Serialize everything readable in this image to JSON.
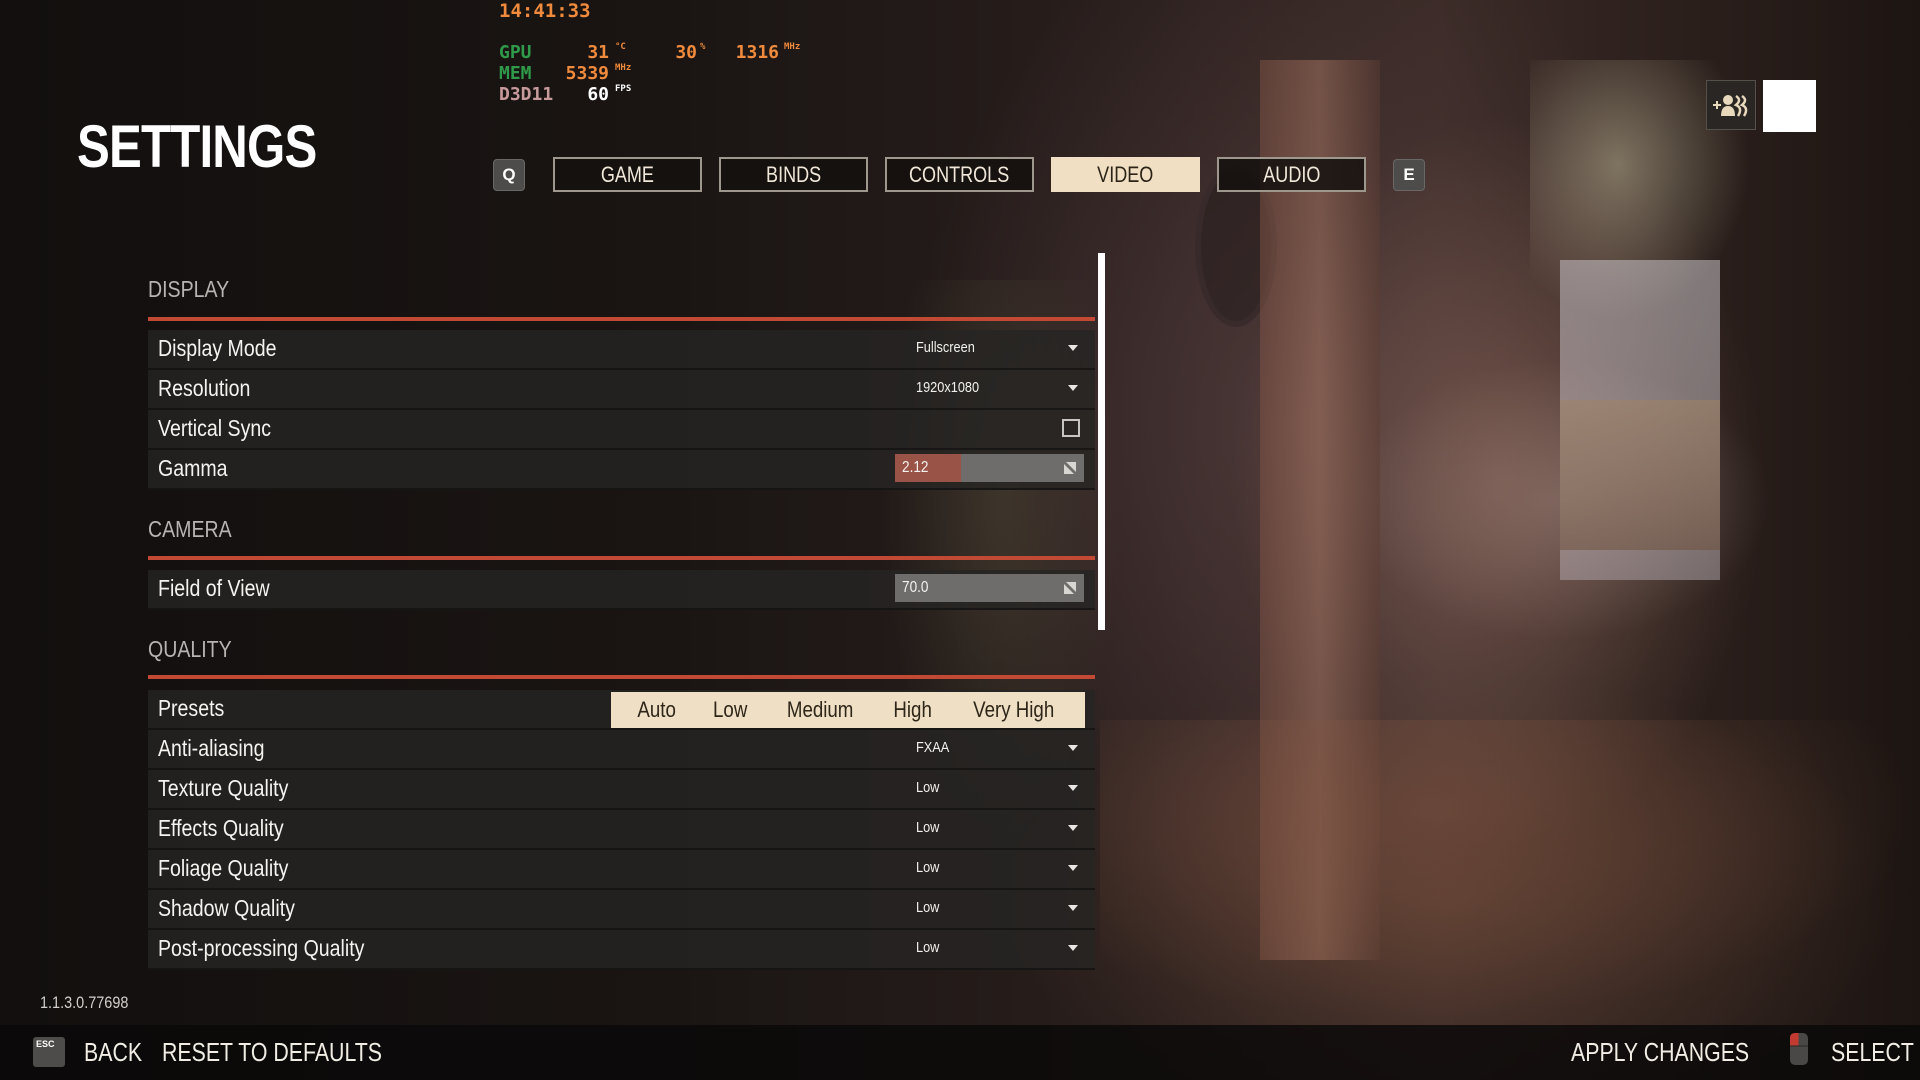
{
  "hud": {
    "time": "14:41:33",
    "gpu": {
      "label": "GPU",
      "temp": "31",
      "temp_unit": "°C",
      "load": "30",
      "load_unit": "%",
      "clock": "1316",
      "clock_unit": "MHz"
    },
    "mem": {
      "label": "MEM",
      "clock": "5339",
      "clock_unit": "MHz"
    },
    "api": {
      "label": "D3D11",
      "fps": "60",
      "fps_unit": "FPS"
    }
  },
  "page_title": "SETTINGS",
  "tabs": {
    "prev_key": "Q",
    "next_key": "E",
    "items": [
      {
        "label": "GAME",
        "active": false
      },
      {
        "label": "BINDS",
        "active": false
      },
      {
        "label": "CONTROLS",
        "active": false
      },
      {
        "label": "VIDEO",
        "active": true
      },
      {
        "label": "AUDIO",
        "active": false
      }
    ]
  },
  "top_right": {
    "squad_icon": "add-squad-icon"
  },
  "sections": {
    "display": {
      "title": "DISPLAY",
      "display_mode": {
        "label": "Display Mode",
        "value": "Fullscreen"
      },
      "resolution": {
        "label": "Resolution",
        "value": "1920x1080"
      },
      "vsync": {
        "label": "Vertical Sync",
        "checked": false
      },
      "gamma": {
        "label": "Gamma",
        "value": "2.12",
        "fill_percent": 35
      }
    },
    "camera": {
      "title": "CAMERA",
      "fov": {
        "label": "Field of View",
        "value": "70.0",
        "fill_percent": 0
      }
    },
    "quality": {
      "title": "QUALITY",
      "presets": {
        "label": "Presets",
        "options": [
          "Auto",
          "Low",
          "Medium",
          "High",
          "Very High"
        ]
      },
      "anti_aliasing": {
        "label": "Anti-aliasing",
        "value": "FXAA"
      },
      "texture": {
        "label": "Texture Quality",
        "value": "Low"
      },
      "effects": {
        "label": "Effects Quality",
        "value": "Low"
      },
      "foliage": {
        "label": "Foliage Quality",
        "value": "Low"
      },
      "shadow": {
        "label": "Shadow Quality",
        "value": "Low"
      },
      "post": {
        "label": "Post-processing Quality",
        "value": "Low"
      }
    }
  },
  "version": "1.1.3.0.77698",
  "footer": {
    "esc_key": "ESC",
    "back": "BACK",
    "reset": "RESET TO DEFAULTS",
    "apply": "APPLY CHANGES",
    "select": "SELECT"
  },
  "colors": {
    "accent_red": "#c24a35",
    "active_tab": "#f0dfc2",
    "hud_orange": "#f08a3c",
    "hud_green": "#2e9a4a",
    "slider_fill": "#9a5447"
  }
}
